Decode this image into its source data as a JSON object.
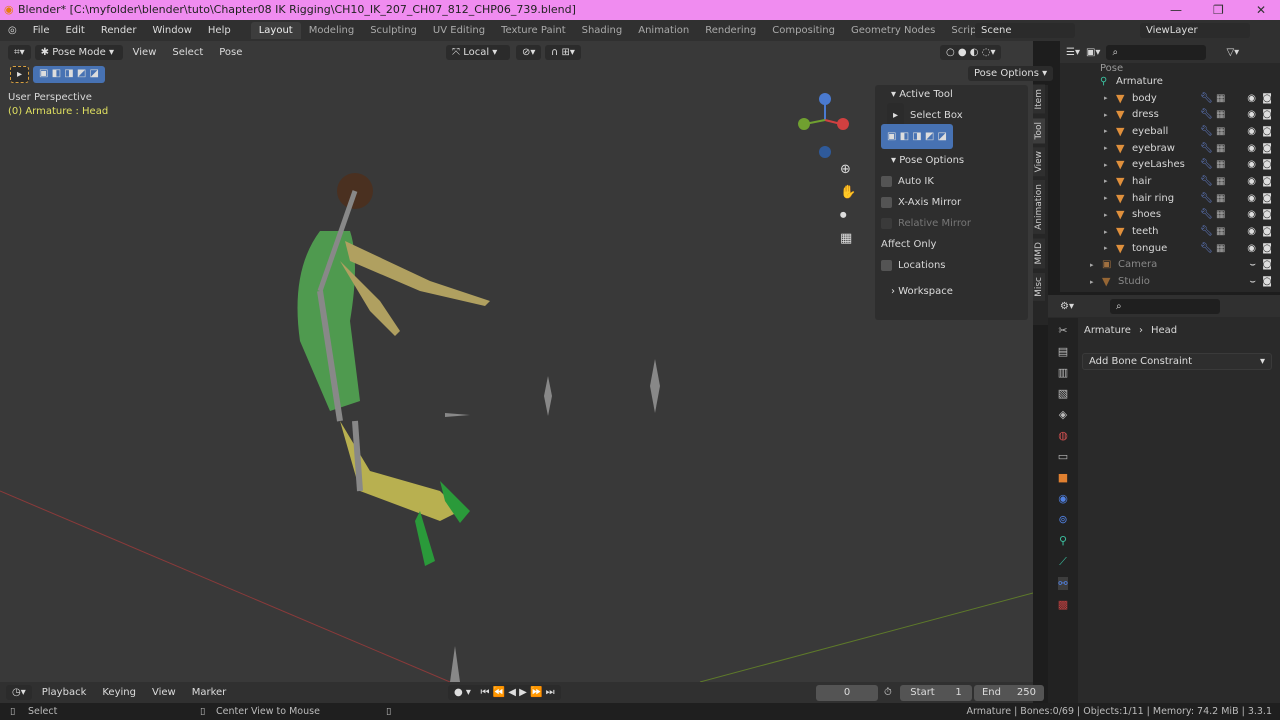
{
  "title": "Blender* [C:\\myfolder\\blender\\tuto\\Chapter08 IK Rigging\\CH10_IK_207_CH07_812_CHP06_739.blend]",
  "menu": [
    "File",
    "Edit",
    "Render",
    "Window",
    "Help"
  ],
  "workspaces": [
    "Layout",
    "Modeling",
    "Sculpting",
    "UV Editing",
    "Texture Paint",
    "Shading",
    "Animation",
    "Rendering",
    "Compositing",
    "Geometry Nodes",
    "Scripting"
  ],
  "scene": "Scene",
  "view_layer": "ViewLayer",
  "viewport": {
    "mode": "Pose Mode",
    "menus": [
      "View",
      "Select",
      "Pose"
    ],
    "orientation": "Local",
    "perspective": "User Perspective",
    "active": "(0) Armature : Head",
    "pose_options": "Pose Options"
  },
  "npanel": {
    "active_tool": "Active Tool",
    "tool": "Select Box",
    "pose_options": "Pose Options",
    "auto_ik": "Auto IK",
    "x_mirror": "X-Axis Mirror",
    "relative_mirror": "Relative Mirror",
    "affect_only": "Affect Only",
    "locations": "Locations",
    "workspace": "Workspace",
    "tabs": [
      "Item",
      "Tool",
      "View",
      "Animation",
      "MMD",
      "Misc"
    ]
  },
  "outliner": {
    "top": "Pose",
    "armature": "Armature",
    "objects": [
      "body",
      "dress",
      "eyeball",
      "eyebraw",
      "eyeLashes",
      "hair",
      "hair ring",
      "shoes",
      "teeth",
      "tongue"
    ],
    "camera": "Camera",
    "studio": "Studio"
  },
  "properties": {
    "breadcrumb_obj": "Armature",
    "breadcrumb_bone": "Head",
    "add_constraint": "Add Bone Constraint"
  },
  "timeline": {
    "menus": [
      "Playback",
      "Keying",
      "View",
      "Marker"
    ],
    "current": "0",
    "start_label": "Start",
    "start": "1",
    "end_label": "End",
    "end": "250"
  },
  "status": {
    "left": "Select",
    "middle": "Center View to Mouse",
    "right": "Armature | Bones:0/69 | Objects:1/11 | Memory: 74.2 MiB | 3.3.1"
  },
  "colors": {
    "titlebar": "#f08cf0",
    "accent": "#4772b3",
    "bone_yellow": "#c8c060",
    "mesh_orange": "#e0903c"
  }
}
